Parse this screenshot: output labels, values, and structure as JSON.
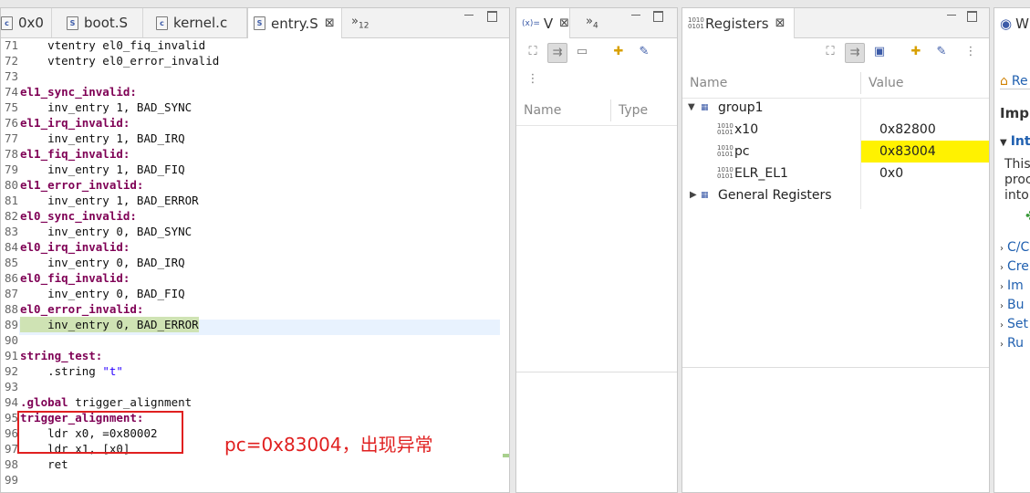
{
  "editor": {
    "tabs": [
      {
        "label": "0x0"
      },
      {
        "label": "boot.S"
      },
      {
        "label": "kernel.c"
      },
      {
        "label": "entry.S"
      }
    ],
    "overflow": "12",
    "lines": [
      {
        "num": "71",
        "text": "    vtentry el0_fiq_invalid"
      },
      {
        "num": "72",
        "text": "    vtentry el0_error_invalid"
      },
      {
        "num": "73",
        "text": ""
      },
      {
        "num": "74",
        "text": "el1_sync_invalid:"
      },
      {
        "num": "75",
        "text": "    inv_entry 1, BAD_SYNC"
      },
      {
        "num": "76",
        "text": "el1_irq_invalid:"
      },
      {
        "num": "77",
        "text": "    inv_entry 1, BAD_IRQ"
      },
      {
        "num": "78",
        "text": "el1_fiq_invalid:"
      },
      {
        "num": "79",
        "text": "    inv_entry 1, BAD_FIQ"
      },
      {
        "num": "80",
        "text": "el1_error_invalid:"
      },
      {
        "num": "81",
        "text": "    inv_entry 1, BAD_ERROR"
      },
      {
        "num": "82",
        "text": "el0_sync_invalid:"
      },
      {
        "num": "83",
        "text": "    inv_entry 0, BAD_SYNC"
      },
      {
        "num": "84",
        "text": "el0_irq_invalid:"
      },
      {
        "num": "85",
        "text": "    inv_entry 0, BAD_IRQ"
      },
      {
        "num": "86",
        "text": "el0_fiq_invalid:"
      },
      {
        "num": "87",
        "text": "    inv_entry 0, BAD_FIQ"
      },
      {
        "num": "88",
        "text": "el0_error_invalid:"
      },
      {
        "num": "89",
        "text": "    inv_entry 0, BAD_ERROR"
      },
      {
        "num": "90",
        "text": ""
      },
      {
        "num": "91",
        "text": "string_test:"
      },
      {
        "num": "92",
        "text": "    .string \"t\""
      },
      {
        "num": "93",
        "text": ""
      },
      {
        "num": "94",
        "text": ".global trigger_alignment"
      },
      {
        "num": "95",
        "text": "trigger_alignment:"
      },
      {
        "num": "96",
        "text": "    ldr x0, =0x80002"
      },
      {
        "num": "97",
        "text": "    ldr x1, [x0]"
      },
      {
        "num": "98",
        "text": "    ret"
      },
      {
        "num": "99",
        "text": ""
      }
    ],
    "annotation": "pc=0x83004，出现异常"
  },
  "variables": {
    "tab_label": "V",
    "overflow": "4",
    "columns": [
      "Name",
      "Type"
    ]
  },
  "registers": {
    "tab_label": "Registers",
    "columns": [
      "Name",
      "Value"
    ],
    "rows": [
      {
        "name": "group1",
        "value": ""
      },
      {
        "name": "x10",
        "value": "0x82800"
      },
      {
        "name": "pc",
        "value": "0x83004"
      },
      {
        "name": "ELR_EL1",
        "value": "0x0"
      },
      {
        "name": "General Registers",
        "value": ""
      }
    ],
    "highlight_color": "#fff200"
  },
  "welcome": {
    "tab_label": "W",
    "items": [
      "Re",
      "Imp",
      "Int",
      "This",
      "proc",
      "into",
      "C/C",
      "Cre",
      "Im",
      "Bu",
      "Set",
      "Ru"
    ]
  },
  "colors": {
    "keyword": "#7f0055",
    "string": "#2a00ff",
    "annotation": "#e02020"
  }
}
